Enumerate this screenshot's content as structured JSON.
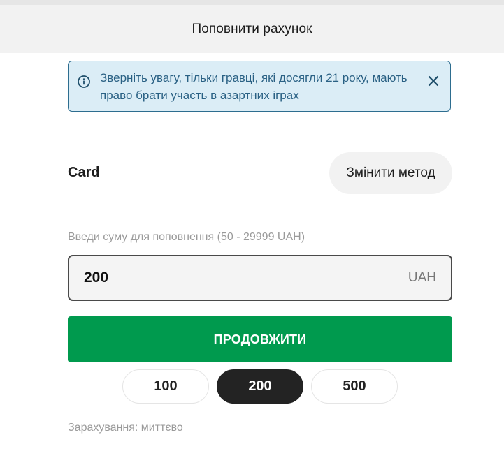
{
  "header": {
    "title": "Поповнити рахунок"
  },
  "notice": {
    "text": "Зверніть увагу, тільки гравці, які досягли 21 року, мають право брати участь в азартних іграх",
    "icon": "info-icon",
    "close_icon": "close-icon"
  },
  "method": {
    "label": "Card",
    "change_label": "Змінити метод"
  },
  "amount": {
    "label": "Введи суму для поповнення (50 - 29999 UAH)",
    "value": "200",
    "currency": "UAH"
  },
  "continue_label": "ПРОДОВЖИТИ",
  "quick_amounts": [
    "100",
    "200",
    "500"
  ],
  "selected_amount": "200",
  "crediting_text": "Зарахування: миттєво",
  "colors": {
    "accent_green": "#009a4e",
    "notice_bg": "#dbedf6",
    "notice_border": "#2d6d8f",
    "notice_text": "#2a6184",
    "chip_active": "#232323"
  }
}
